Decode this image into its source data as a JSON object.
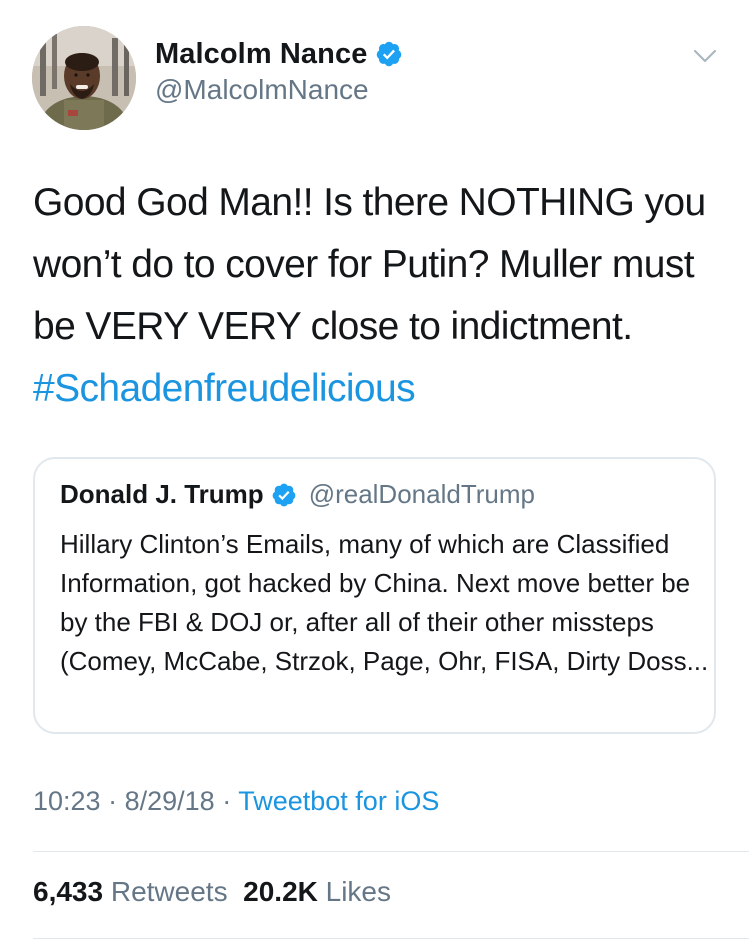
{
  "author": {
    "display_name": "Malcolm Nance",
    "handle": "@MalcolmNance",
    "verified": true
  },
  "tweet": {
    "text": "Good God Man!! Is there NOTHING you won’t do to cover for Putin? Muller must be VERY VERY close to indictment. ",
    "hashtag": "#Schadenfreudelicious"
  },
  "quoted_tweet": {
    "display_name": "Donald J. Trump",
    "handle": "@realDonaldTrump",
    "verified": true,
    "text": "Hillary Clinton’s Emails, many of which are Classified Information, got hacked by China. Next move better be by the FBI & DOJ or, after all of their other missteps (Comey, McCabe, Strzok, Page, Ohr, FISA, Dirty Doss..."
  },
  "meta": {
    "time": "10:23",
    "separator": "·",
    "date": "8/29/18",
    "source": "Tweetbot for iOS"
  },
  "stats": {
    "retweets_count": "6,433",
    "retweets_label": "Retweets",
    "likes_count": "20.2K",
    "likes_label": "Likes"
  },
  "colors": {
    "link": "#1b95e0",
    "secondary_text": "#657786",
    "primary_text": "#14171a",
    "border": "#e1e8ed"
  },
  "icons": {
    "verified": "verified-badge-icon",
    "menu": "chevron-down-icon"
  }
}
